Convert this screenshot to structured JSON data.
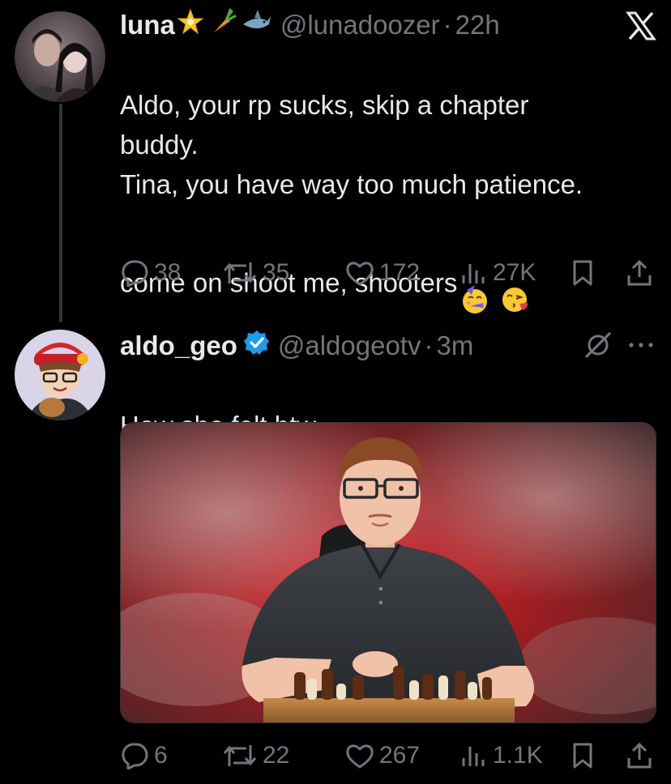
{
  "tweet1": {
    "name": "luna",
    "emojis": [
      "star-icon",
      "carrot-icon",
      "shark-icon"
    ],
    "handle": "@lunadoozer",
    "sep": "·",
    "time": "22h",
    "body": "Aldo, your rp sucks, skip a chapter\nbuddy.\nTina, you have way too much patience.\n\ncome on shoot me, shooters",
    "body_emojis": [
      "partying-face-icon",
      "kissing-heart-face-icon"
    ],
    "stats": {
      "replies": "38",
      "reposts": "35",
      "likes": "172",
      "views": "27K"
    }
  },
  "tweet2": {
    "name": "aldo_geo",
    "verified": true,
    "handle": "@aldogeotv",
    "sep": "·",
    "time": "3m",
    "body": "How she felt btw",
    "media_description_icon": "chess-player-photo",
    "stats": {
      "replies": "6",
      "reposts": "22",
      "likes": "267",
      "views": "1.1K"
    }
  },
  "colors": {
    "background": "#000000",
    "text": "#e7e9ea",
    "muted": "#71767b",
    "verified": "#1d9bf0"
  }
}
